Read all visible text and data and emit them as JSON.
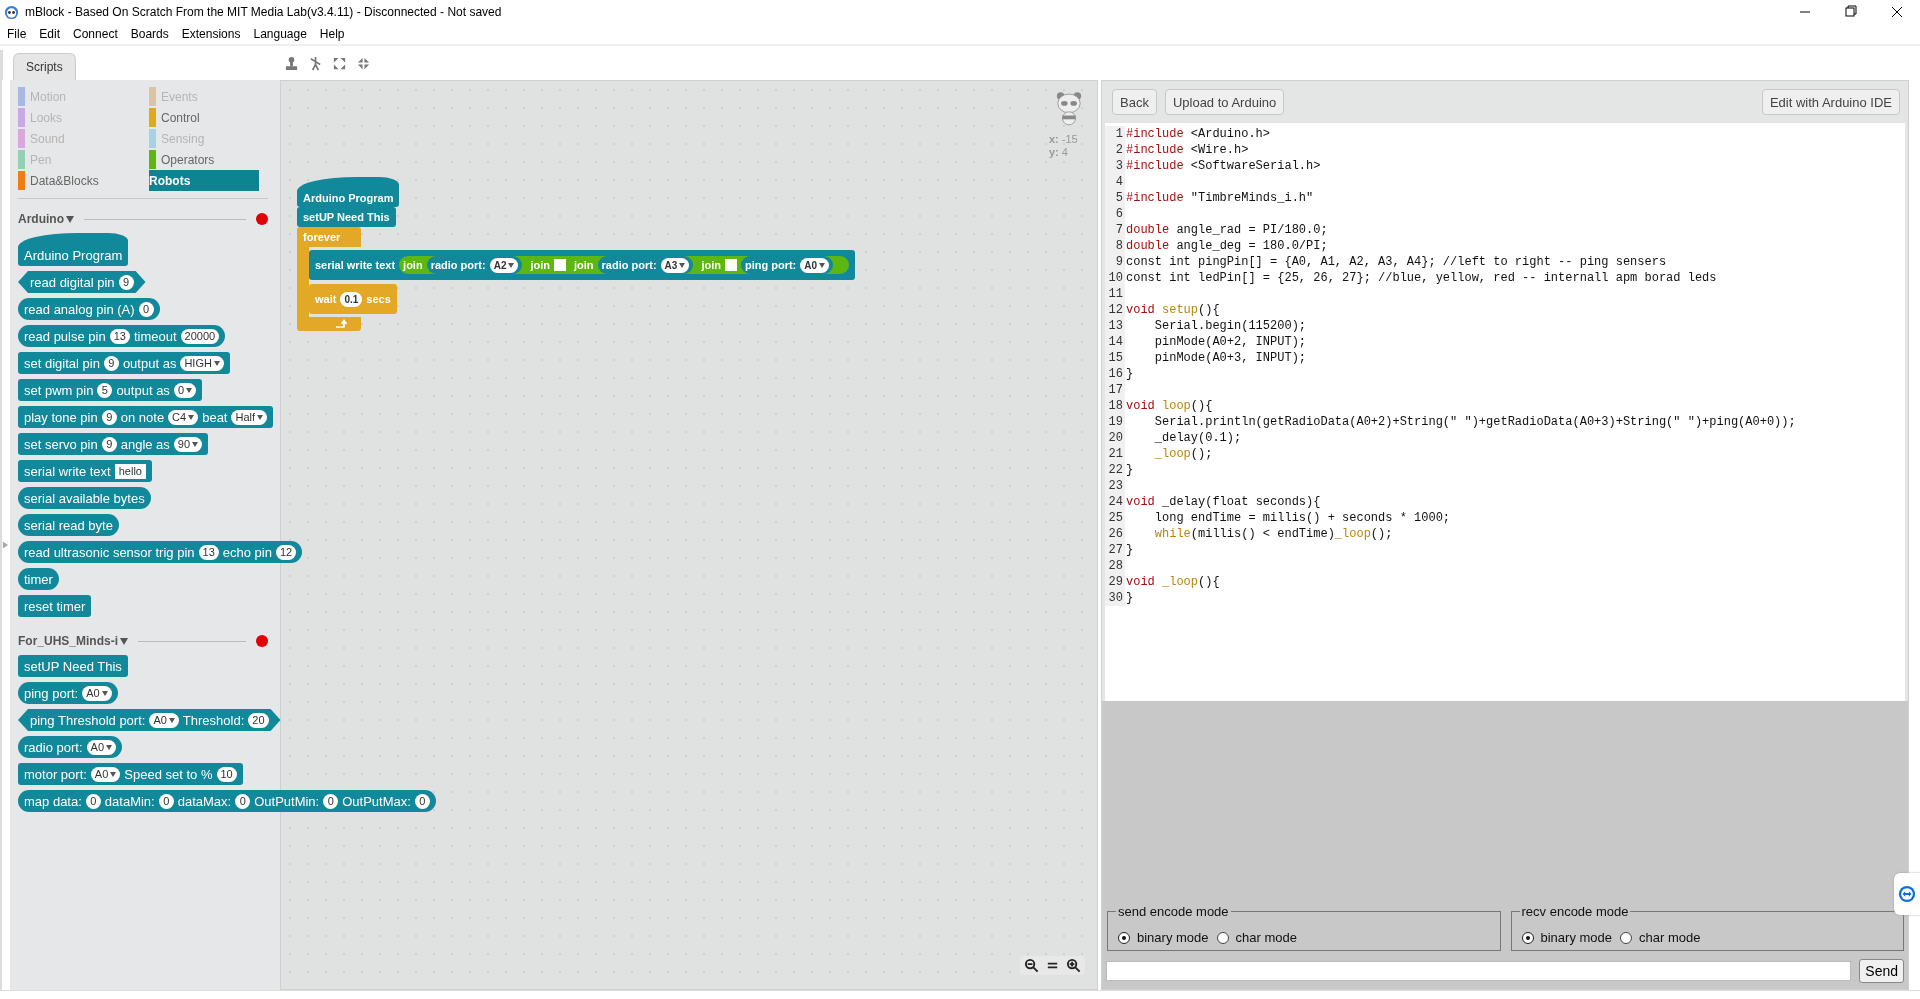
{
  "window": {
    "title": "mBlock - Based On Scratch From the MIT Media Lab(v3.4.11) - Disconnected - Not saved"
  },
  "menu": [
    "File",
    "Edit",
    "Connect",
    "Boards",
    "Extensions",
    "Language",
    "Help"
  ],
  "tabs": [
    {
      "label": "Scripts",
      "selected": true
    }
  ],
  "palette": {
    "categories": [
      {
        "label": "Motion",
        "color": "#aab7e3",
        "disabled": true,
        "selected": false
      },
      {
        "label": "Events",
        "color": "#dcc3a2",
        "disabled": true,
        "selected": false
      },
      {
        "label": "Looks",
        "color": "#c7a9e3",
        "disabled": true,
        "selected": false
      },
      {
        "label": "Control",
        "color": "#e1a91a",
        "disabled": false,
        "selected": false
      },
      {
        "label": "Sound",
        "color": "#d8a8dc",
        "disabled": true,
        "selected": false
      },
      {
        "label": "Sensing",
        "color": "#a6d2e8",
        "disabled": true,
        "selected": false
      },
      {
        "label": "Pen",
        "color": "#96cfb8",
        "disabled": true,
        "selected": false
      },
      {
        "label": "Operators",
        "color": "#5cb712",
        "disabled": false,
        "selected": false
      },
      {
        "label": "Data&Blocks",
        "color": "#ee7d16",
        "disabled": false,
        "selected": false
      },
      {
        "label": "Robots",
        "color": "#0e8493",
        "disabled": false,
        "selected": true
      }
    ],
    "sections": [
      {
        "title": "Arduino",
        "blocks": [
          {
            "kind": "hat",
            "color": "#12899a",
            "parts": [
              {
                "kind": "label",
                "t": "Arduino Program"
              }
            ]
          },
          {
            "kind": "boolean",
            "color": "#12899a",
            "parts": [
              {
                "kind": "label",
                "t": "read digital pin"
              },
              {
                "kind": "num",
                "t": "9"
              }
            ]
          },
          {
            "kind": "reporter",
            "color": "#12899a",
            "parts": [
              {
                "kind": "label",
                "t": "read analog pin (A)"
              },
              {
                "kind": "num",
                "t": "0"
              }
            ]
          },
          {
            "kind": "reporter",
            "color": "#12899a",
            "parts": [
              {
                "kind": "label",
                "t": "read pulse pin"
              },
              {
                "kind": "num",
                "t": "13"
              },
              {
                "kind": "label",
                "t": "timeout"
              },
              {
                "kind": "num",
                "t": "20000"
              }
            ]
          },
          {
            "kind": "command",
            "color": "#12899a",
            "parts": [
              {
                "kind": "label",
                "t": "set digital pin"
              },
              {
                "kind": "num",
                "t": "9"
              },
              {
                "kind": "label",
                "t": "output as"
              },
              {
                "kind": "drop",
                "t": "HIGH"
              }
            ]
          },
          {
            "kind": "command",
            "color": "#12899a",
            "parts": [
              {
                "kind": "label",
                "t": "set pwm pin"
              },
              {
                "kind": "num",
                "t": "5"
              },
              {
                "kind": "label",
                "t": "output as"
              },
              {
                "kind": "drop",
                "t": "0"
              }
            ]
          },
          {
            "kind": "command",
            "color": "#12899a",
            "parts": [
              {
                "kind": "label",
                "t": "play tone pin"
              },
              {
                "kind": "num",
                "t": "9"
              },
              {
                "kind": "label",
                "t": "on note"
              },
              {
                "kind": "drop",
                "t": "C4"
              },
              {
                "kind": "label",
                "t": "beat"
              },
              {
                "kind": "drop",
                "t": "Half"
              }
            ]
          },
          {
            "kind": "command",
            "color": "#12899a",
            "parts": [
              {
                "kind": "label",
                "t": "set servo pin"
              },
              {
                "kind": "num",
                "t": "9"
              },
              {
                "kind": "label",
                "t": "angle as"
              },
              {
                "kind": "drop",
                "t": "90"
              }
            ]
          },
          {
            "kind": "command",
            "color": "#12899a",
            "parts": [
              {
                "kind": "label",
                "t": "serial write text"
              },
              {
                "kind": "text",
                "t": "hello"
              }
            ]
          },
          {
            "kind": "reporter",
            "color": "#12899a",
            "parts": [
              {
                "kind": "label",
                "t": "serial available bytes"
              }
            ]
          },
          {
            "kind": "reporter",
            "color": "#12899a",
            "parts": [
              {
                "kind": "label",
                "t": "serial read byte"
              }
            ]
          },
          {
            "kind": "reporter",
            "color": "#12899a",
            "parts": [
              {
                "kind": "label",
                "t": "read ultrasonic sensor trig pin"
              },
              {
                "kind": "num",
                "t": "13"
              },
              {
                "kind": "label",
                "t": "echo pin"
              },
              {
                "kind": "num",
                "t": "12"
              }
            ]
          },
          {
            "kind": "reporter",
            "color": "#12899a",
            "parts": [
              {
                "kind": "label",
                "t": "timer"
              }
            ]
          },
          {
            "kind": "command",
            "color": "#12899a",
            "parts": [
              {
                "kind": "label",
                "t": "reset timer"
              }
            ]
          }
        ]
      },
      {
        "title": "For_UHS_Minds-i",
        "blocks": [
          {
            "kind": "command",
            "color": "#12899a",
            "parts": [
              {
                "kind": "label",
                "t": "setUP Need This"
              }
            ]
          },
          {
            "kind": "reporter",
            "color": "#12899a",
            "parts": [
              {
                "kind": "label",
                "t": "ping port:"
              },
              {
                "kind": "drop",
                "t": "A0"
              }
            ]
          },
          {
            "kind": "boolean",
            "color": "#12899a",
            "parts": [
              {
                "kind": "label",
                "t": "ping Threshold port:"
              },
              {
                "kind": "drop",
                "t": "A0"
              },
              {
                "kind": "label",
                "t": "Threshold:"
              },
              {
                "kind": "num",
                "t": "20"
              }
            ]
          },
          {
            "kind": "reporter",
            "color": "#12899a",
            "parts": [
              {
                "kind": "label",
                "t": "radio port:"
              },
              {
                "kind": "drop",
                "t": "A0"
              }
            ]
          },
          {
            "kind": "command",
            "color": "#12899a",
            "parts": [
              {
                "kind": "label",
                "t": "motor port:"
              },
              {
                "kind": "drop",
                "t": "A0"
              },
              {
                "kind": "label",
                "t": "Speed set to %"
              },
              {
                "kind": "num",
                "t": "10"
              }
            ]
          },
          {
            "kind": "reporter",
            "color": "#12899a",
            "parts": [
              {
                "kind": "label",
                "t": "map data:"
              },
              {
                "kind": "num",
                "t": "0"
              },
              {
                "kind": "label",
                "t": "dataMin:"
              },
              {
                "kind": "num",
                "t": "0"
              },
              {
                "kind": "label",
                "t": "dataMax:"
              },
              {
                "kind": "num",
                "t": "0"
              },
              {
                "kind": "label",
                "t": "OutPutMin:"
              },
              {
                "kind": "num",
                "t": "0"
              },
              {
                "kind": "label",
                "t": "OutPutMax:"
              },
              {
                "kind": "num",
                "t": "0"
              }
            ]
          }
        ]
      }
    ]
  },
  "script": [
    {
      "kind": "hat",
      "color": "#12899a",
      "parts": [
        {
          "kind": "label",
          "t": "Arduino Program"
        }
      ]
    },
    {
      "kind": "command",
      "color": "#12899a",
      "parts": [
        {
          "kind": "label",
          "t": "setUP Need This"
        }
      ]
    },
    {
      "kind": "c",
      "color": "#e3a825",
      "parts": [
        {
          "kind": "label",
          "t": "forever"
        }
      ],
      "inner": [
        {
          "kind": "command",
          "color": "#12899a",
          "parts": [
            {
              "kind": "label",
              "t": "serial write text"
            },
            {
              "kind": "reporter",
              "color": "#5cb712",
              "parts": [
                {
                  "kind": "label",
                  "t": "join"
                },
                {
                  "kind": "reporter",
                  "color": "#12899a",
                  "parts": [
                    {
                      "kind": "label",
                      "t": "radio port:"
                    },
                    {
                      "kind": "drop",
                      "t": "A2"
                    }
                  ]
                },
                {
                  "kind": "reporter",
                  "color": "#5cb712",
                  "parts": [
                    {
                      "kind": "label",
                      "t": "join"
                    },
                    {
                      "kind": "empty"
                    },
                    {
                      "kind": "reporter",
                      "color": "#5cb712",
                      "parts": [
                        {
                          "kind": "label",
                          "t": "join"
                        },
                        {
                          "kind": "reporter",
                          "color": "#12899a",
                          "parts": [
                            {
                              "kind": "label",
                              "t": "radio port:"
                            },
                            {
                              "kind": "drop",
                              "t": "A3"
                            }
                          ]
                        },
                        {
                          "kind": "reporter",
                          "color": "#5cb712",
                          "parts": [
                            {
                              "kind": "label",
                              "t": "join"
                            },
                            {
                              "kind": "empty"
                            },
                            {
                              "kind": "reporter",
                              "color": "#12899a",
                              "parts": [
                                {
                                  "kind": "label",
                                  "t": "ping port:"
                                },
                                {
                                  "kind": "drop",
                                  "t": "A0"
                                }
                              ]
                            }
                          ]
                        }
                      ]
                    }
                  ]
                }
              ]
            }
          ]
        },
        {
          "kind": "command",
          "color": "#e3a825",
          "parts": [
            {
              "kind": "label",
              "t": "wait"
            },
            {
              "kind": "num",
              "t": "0.1"
            },
            {
              "kind": "label",
              "t": "secs"
            }
          ]
        }
      ]
    }
  ],
  "sprite": {
    "x": "**x:** -15",
    "y": "**y:** 4"
  },
  "code_panel": {
    "left_buttons": [
      "Back",
      "Upload to Arduino"
    ],
    "right_button": "Edit with Arduino IDE",
    "lines": [
      {
        "n": "1",
        "parts": [
          {
            "kind": "kw",
            "t": "#include"
          },
          {
            "kind": "plain",
            "t": " <Arduino.h>"
          }
        ]
      },
      {
        "n": "2",
        "parts": [
          {
            "kind": "kw",
            "t": "#include"
          },
          {
            "kind": "plain",
            "t": " <Wire.h>"
          }
        ]
      },
      {
        "n": "3",
        "parts": [
          {
            "kind": "kw",
            "t": "#include"
          },
          {
            "kind": "plain",
            "t": " <SoftwareSerial.h>"
          }
        ]
      },
      {
        "n": "4"
      },
      {
        "n": "5",
        "parts": [
          {
            "kind": "kw",
            "t": "#include"
          },
          {
            "kind": "plain",
            "t": " \"TimbreMinds_i.h\""
          }
        ]
      },
      {
        "n": "6"
      },
      {
        "n": "7",
        "parts": [
          {
            "kind": "kw",
            "t": "double"
          },
          {
            "kind": "plain",
            "t": " angle_rad = PI/180.0;"
          }
        ]
      },
      {
        "n": "8",
        "parts": [
          {
            "kind": "kw",
            "t": "double"
          },
          {
            "kind": "plain",
            "t": " angle_deg = 180.0/PI;"
          }
        ]
      },
      {
        "n": "9",
        "parts": [
          {
            "kind": "plain",
            "t": "const int pingPin[] = {A0, A1, A2, A3, A4}; //left to right -- ping sensers"
          }
        ]
      },
      {
        "n": "10",
        "parts": [
          {
            "kind": "plain",
            "t": "const int ledPin[] = {25, 26, 27}; //blue, yellow, red -- internall apm borad leds"
          }
        ]
      },
      {
        "n": "11"
      },
      {
        "n": "12",
        "parts": [
          {
            "kind": "kw",
            "t": "void"
          },
          {
            "kind": "fn",
            "t": " setup"
          },
          {
            "kind": "plain",
            "t": "(){"
          }
        ]
      },
      {
        "n": "13",
        "parts": [
          {
            "kind": "plain",
            "t": "    Serial.begin(115200);"
          }
        ]
      },
      {
        "n": "14",
        "parts": [
          {
            "kind": "plain",
            "t": "    pinMode(A0+2, INPUT);"
          }
        ]
      },
      {
        "n": "15",
        "parts": [
          {
            "kind": "plain",
            "t": "    pinMode(A0+3, INPUT);"
          }
        ]
      },
      {
        "n": "16",
        "parts": [
          {
            "kind": "plain",
            "t": "}"
          }
        ]
      },
      {
        "n": "17"
      },
      {
        "n": "18",
        "parts": [
          {
            "kind": "kw",
            "t": "void"
          },
          {
            "kind": "fn",
            "t": " loop"
          },
          {
            "kind": "plain",
            "t": "(){"
          }
        ]
      },
      {
        "n": "19",
        "parts": [
          {
            "kind": "plain",
            "t": "    Serial.println(getRadioData(A0+2)+String(\" \")+getRadioData(A0+3)+String(\" \")+ping(A0+0));"
          }
        ]
      },
      {
        "n": "20",
        "parts": [
          {
            "kind": "plain",
            "t": "    _delay(0.1);"
          }
        ]
      },
      {
        "n": "21",
        "parts": [
          {
            "kind": "fn",
            "t": "    _loop"
          },
          {
            "kind": "plain",
            "t": "();"
          }
        ]
      },
      {
        "n": "22",
        "parts": [
          {
            "kind": "plain",
            "t": "}"
          }
        ]
      },
      {
        "n": "23"
      },
      {
        "n": "24",
        "parts": [
          {
            "kind": "kw",
            "t": "void"
          },
          {
            "kind": "plain",
            "t": " _delay(float seconds){"
          }
        ]
      },
      {
        "n": "25",
        "parts": [
          {
            "kind": "plain",
            "t": "    long endTime = millis() + seconds * 1000;"
          }
        ]
      },
      {
        "n": "26",
        "parts": [
          {
            "kind": "fn",
            "t": "    while"
          },
          {
            "kind": "plain",
            "t": "(millis() < endTime)"
          },
          {
            "kind": "fn",
            "t": "_loop"
          },
          {
            "kind": "plain",
            "t": "();"
          }
        ]
      },
      {
        "n": "27",
        "parts": [
          {
            "kind": "plain",
            "t": "}"
          }
        ]
      },
      {
        "n": "28"
      },
      {
        "n": "29",
        "parts": [
          {
            "kind": "kw",
            "t": "void"
          },
          {
            "kind": "fn",
            "t": " _loop"
          },
          {
            "kind": "plain",
            "t": "(){"
          }
        ]
      },
      {
        "n": "30",
        "parts": [
          {
            "kind": "plain",
            "t": "}"
          }
        ]
      }
    ]
  },
  "serial": {
    "groups": [
      {
        "legend": "send encode mode",
        "options": [
          {
            "label": "binary mode",
            "selected": true
          },
          {
            "label": "char mode",
            "selected": false
          }
        ]
      },
      {
        "legend": "recv encode mode",
        "options": [
          {
            "label": "binary mode",
            "selected": true
          },
          {
            "label": "char mode",
            "selected": false
          }
        ]
      }
    ],
    "send_button": "Send"
  }
}
